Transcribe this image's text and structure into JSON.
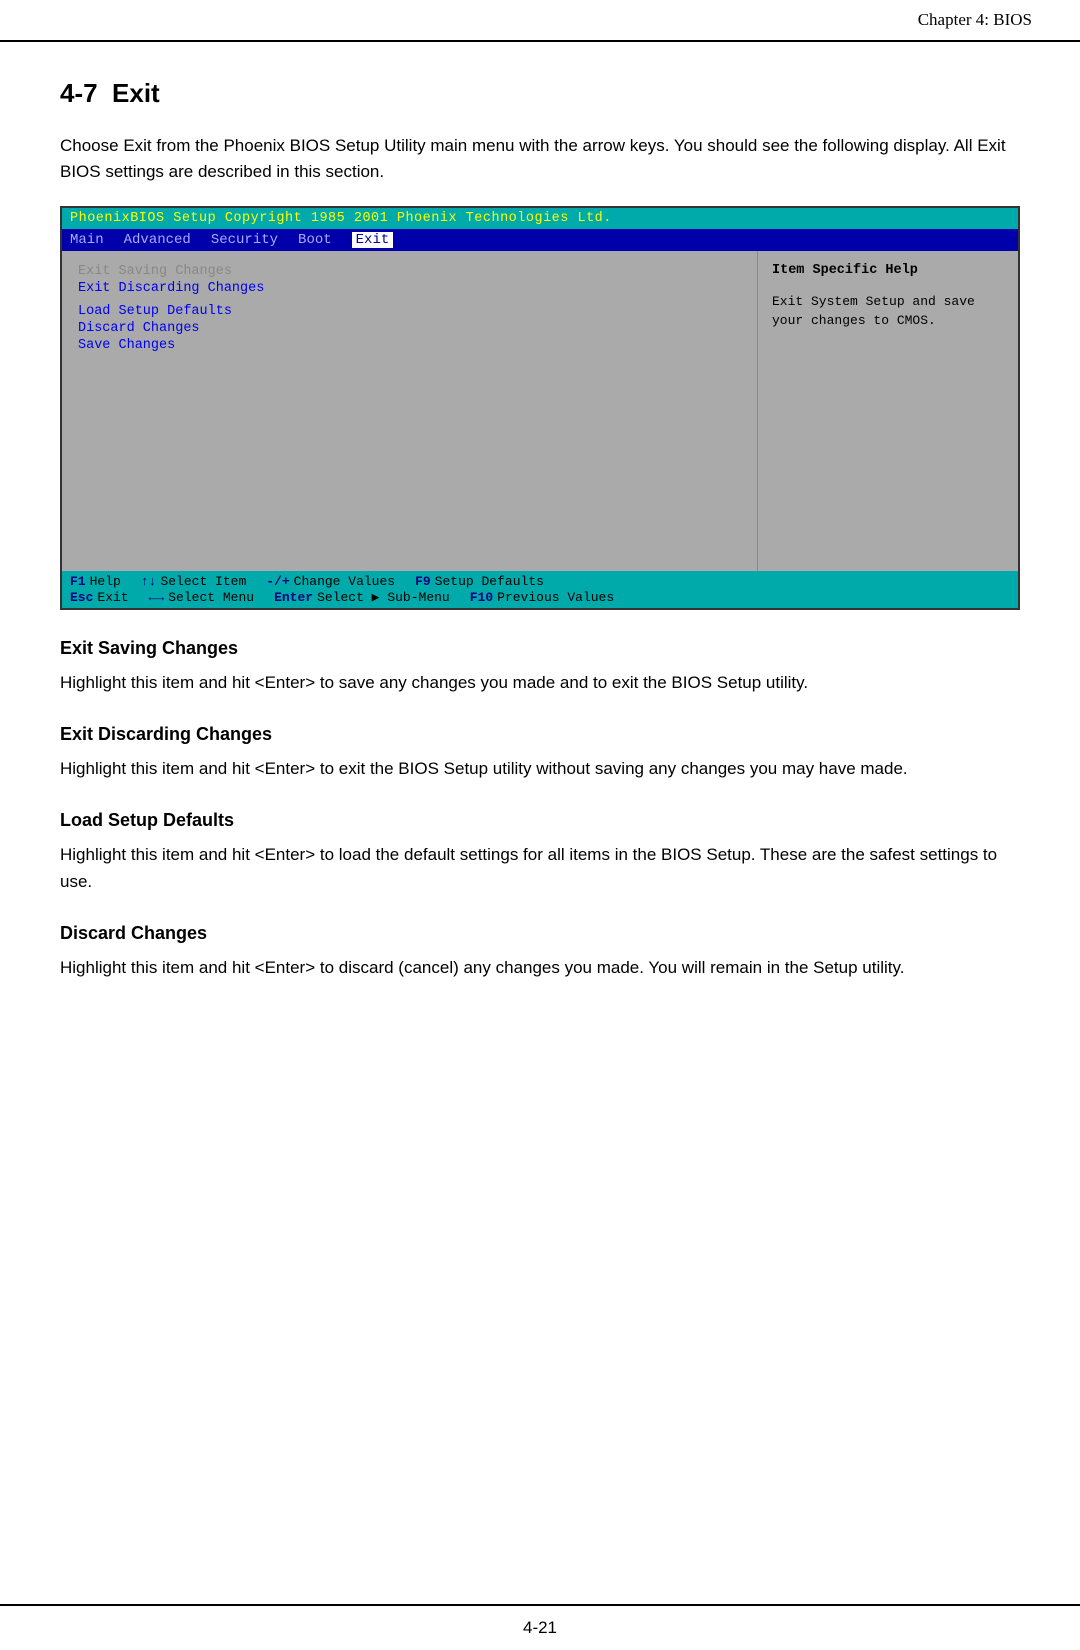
{
  "header": {
    "label": "Chapter 4: BIOS"
  },
  "section": {
    "number": "4-7",
    "title": "Exit",
    "intro": "Choose Exit from the Phoenix BIOS Setup Utility main menu with the arrow keys. You should see the following display.  All Exit BIOS settings are described in this section."
  },
  "bios": {
    "title_bar": "PhoenixBIOS Setup    Copyright 1985 2001 Phoenix Technologies Ltd.",
    "menu_items": [
      "Main",
      "Advanced",
      "Security",
      "Boot",
      "Exit"
    ],
    "active_menu": "Exit",
    "left_items": [
      {
        "label": "Exit Saving Changes",
        "highlighted": false
      },
      {
        "label": "Exit Discarding Changes",
        "highlighted": true
      },
      {
        "label": "Load Setup Defaults",
        "highlighted": true
      },
      {
        "label": "Discard Changes",
        "highlighted": true
      },
      {
        "label": "Save Changes",
        "highlighted": true
      }
    ],
    "help_title": "Item Specific Help",
    "help_text": "Exit System Setup and save your changes to CMOS.",
    "bottom_rows": [
      [
        {
          "key": "F1",
          "label": "Help"
        },
        {
          "key": "↑↓",
          "label": "Select Item"
        },
        {
          "key": "-/+",
          "label": "Change Values"
        },
        {
          "key": "F9",
          "label": "Setup Defaults"
        }
      ],
      [
        {
          "key": "Esc",
          "label": "Exit"
        },
        {
          "key": "←→",
          "label": "Select Menu"
        },
        {
          "key": "Enter",
          "label": "Select ▶ Sub-Menu"
        },
        {
          "key": "F10",
          "label": "Previous Values"
        }
      ]
    ]
  },
  "subsections": [
    {
      "id": "exit-saving-changes",
      "title": "Exit Saving Changes",
      "text": "Highlight this item and hit <Enter> to save any changes you made and to exit the BIOS Setup utility."
    },
    {
      "id": "exit-discarding-changes",
      "title": "Exit Discarding Changes",
      "text": "Highlight this item and hit <Enter> to exit the BIOS Setup utility without saving any changes you may have made."
    },
    {
      "id": "load-setup-defaults",
      "title": "Load Setup Defaults",
      "text": "Highlight this item and hit <Enter> to load the default settings for all items in the BIOS Setup.  These are the safest settings to use."
    },
    {
      "id": "discard-changes",
      "title": "Discard Changes",
      "text": "Highlight this item and hit <Enter> to discard (cancel) any changes you made.  You will remain in the Setup utility."
    }
  ],
  "footer": {
    "page_number": "4-21"
  }
}
